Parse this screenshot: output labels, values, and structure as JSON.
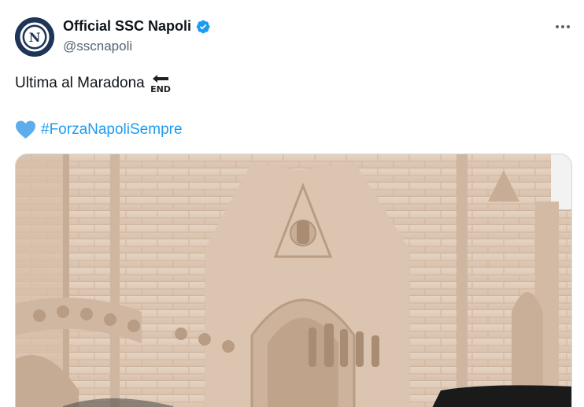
{
  "account": {
    "name": "Official SSC Napoli",
    "handle": "@sscnapoli",
    "avatar_letter": "N",
    "verified_icon": "verified-badge-icon"
  },
  "tweet": {
    "text": "Ultima al Maradona",
    "text_emoji": "end-arrow-emoji",
    "heart_emoji": "blue-heart-emoji",
    "hashtag": "#ForzaNapoliSempre"
  },
  "menu": {
    "icon": "more-icon"
  },
  "media": {
    "description_icon": "photo-cathedral"
  },
  "colors": {
    "text": "#0f1419",
    "secondary": "#536471",
    "link": "#1d9bf0",
    "verified": "#1d9bf0",
    "avatar_bg": "#1d3557"
  }
}
